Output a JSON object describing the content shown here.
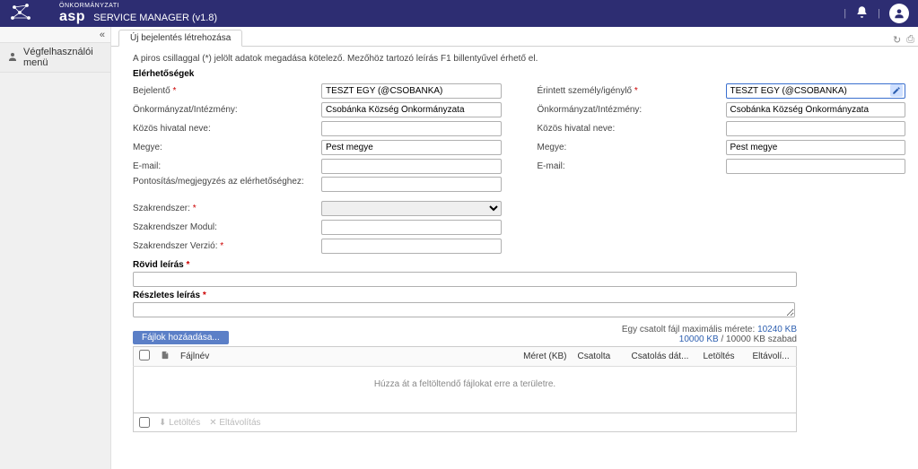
{
  "app": {
    "brand_sup": "ÖNKORMÁNYZATI",
    "brand": "asp",
    "title": "SERVICE MANAGER (v1.8)"
  },
  "sidebar": {
    "menu_item": "Végfelhasználói menü"
  },
  "tab": {
    "label": "Új bejelentés létrehozása"
  },
  "form": {
    "required_note": "A piros csillaggal (*) jelölt adatok megadása kötelező. Mezőhöz tartozó leírás F1 billentyűvel érhető el.",
    "section_elerhetosegek": "Elérhetőségek",
    "left": {
      "bejelento_label": "Bejelentő",
      "bejelento_value": "TESZT EGY (@CSOBANKA)",
      "onkorm_label": "Önkormányzat/Intézmény:",
      "onkorm_value": "Csobánka Község Önkormányzata",
      "kozos_label": "Közös hivatal neve:",
      "kozos_value": "",
      "megye_label": "Megye:",
      "megye_value": "Pest megye",
      "email_label": "E-mail:",
      "email_value": "",
      "pontositas_label": "Pontosítás/megjegyzés az elérhetőséghez:",
      "pontositas_value": "",
      "szakrendszer_label": "Szakrendszer:",
      "szakrendszer_value": "",
      "szak_modul_label": "Szakrendszer Modul:",
      "szak_modul_value": "",
      "szak_verzio_label": "Szakrendszer Verzió:",
      "szak_verzio_value": ""
    },
    "right": {
      "erintett_label": "Érintett személy/igénylő",
      "erintett_value": "TESZT EGY (@CSOBANKA)",
      "onkorm_label": "Önkormányzat/Intézmény:",
      "onkorm_value": "Csobánka Község Önkormányzata",
      "kozos_label": "Közös hivatal neve:",
      "kozos_value": "",
      "megye_label": "Megye:",
      "megye_value": "Pest megye",
      "email_label": "E-mail:",
      "email_value": ""
    },
    "rovid_label": "Rövid leírás",
    "rovid_value": "",
    "reszletes_label": "Részletes leírás",
    "reszletes_value": ""
  },
  "attachments": {
    "add_label": "Fájlok hozáadása...",
    "max_text_pre": "Egy csatolt fájl maximális mérete: ",
    "max_size": "10240 KB",
    "quota_used": "10000 KB",
    "quota_sep": " / ",
    "quota_text_post": "10000 KB szabad",
    "cols": {
      "filename": "Fájlnév",
      "size": "Méret (KB)",
      "csatolta": "Csatolta",
      "date": "Csatolás dát...",
      "download": "Letöltés",
      "remove": "Eltávolí..."
    },
    "dropzone_text": "Húzza át a feltöltendő fájlokat erre a területre.",
    "footer_download": "Letöltés",
    "footer_remove": "Eltávolítás"
  }
}
